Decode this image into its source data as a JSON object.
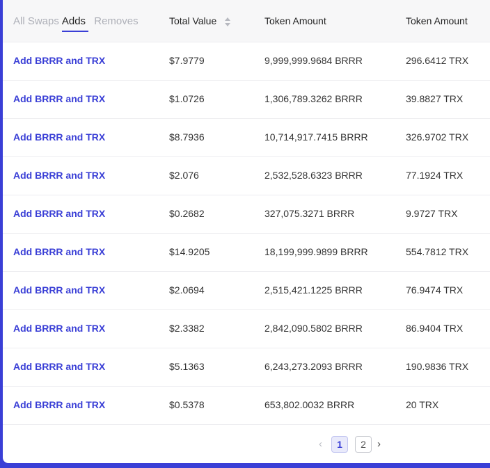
{
  "filters": [
    {
      "label": "All Swaps",
      "active": false
    },
    {
      "label": "Adds",
      "active": true
    },
    {
      "label": "Removes",
      "active": false
    }
  ],
  "columns": {
    "total_value": "Total Value",
    "token_amount_1": "Token Amount",
    "token_amount_2": "Token Amount"
  },
  "rows": [
    {
      "action": "Add BRRR and TRX",
      "value": "$7.9779",
      "amount1": "9,999,999.9684 BRRR",
      "amount2": "296.6412 TRX"
    },
    {
      "action": "Add BRRR and TRX",
      "value": "$1.0726",
      "amount1": "1,306,789.3262 BRRR",
      "amount2": "39.8827 TRX"
    },
    {
      "action": "Add BRRR and TRX",
      "value": "$8.7936",
      "amount1": "10,714,917.7415 BRRR",
      "amount2": "326.9702 TRX"
    },
    {
      "action": "Add BRRR and TRX",
      "value": "$2.076",
      "amount1": "2,532,528.6323 BRRR",
      "amount2": "77.1924 TRX"
    },
    {
      "action": "Add BRRR and TRX",
      "value": "$0.2682",
      "amount1": "327,075.3271 BRRR",
      "amount2": "9.9727 TRX"
    },
    {
      "action": "Add BRRR and TRX",
      "value": "$14.9205",
      "amount1": "18,199,999.9899 BRRR",
      "amount2": "554.7812 TRX"
    },
    {
      "action": "Add BRRR and TRX",
      "value": "$2.0694",
      "amount1": "2,515,421.1225 BRRR",
      "amount2": "76.9474 TRX"
    },
    {
      "action": "Add BRRR and TRX",
      "value": "$2.3382",
      "amount1": "2,842,090.5802 BRRR",
      "amount2": "86.9404 TRX"
    },
    {
      "action": "Add BRRR and TRX",
      "value": "$5.1363",
      "amount1": "6,243,273.2093 BRRR",
      "amount2": "190.9836 TRX"
    },
    {
      "action": "Add BRRR and TRX",
      "value": "$0.5378",
      "amount1": "653,802.0032 BRRR",
      "amount2": "20 TRX"
    }
  ],
  "pagination": {
    "prev_icon": "chevron-left-icon",
    "next_icon": "chevron-right-icon",
    "pages": [
      "1",
      "2"
    ],
    "current": "1"
  },
  "colors": {
    "accent": "#3a3fd6",
    "header_bg": "#f7f7f8",
    "muted_text": "#aeb0b8"
  }
}
